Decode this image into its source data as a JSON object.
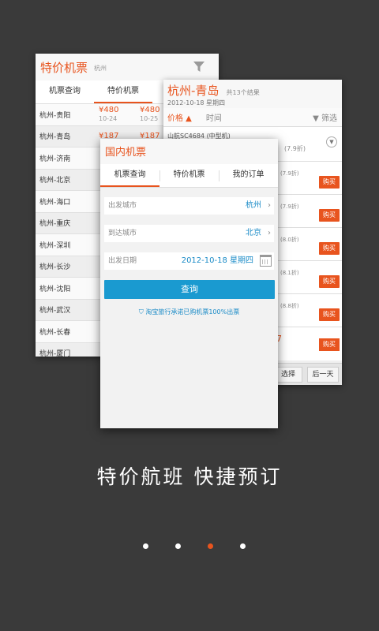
{
  "card1": {
    "title": "特价机票",
    "subtitle": "杭州",
    "tabs": [
      "机票查询",
      "特价机票"
    ],
    "rows": [
      {
        "city": "杭州-贵阳",
        "p1": "¥480",
        "d1": "10-24",
        "p2": "¥480",
        "d2": "10-25"
      },
      {
        "city": "杭州-青岛",
        "p1": "¥187",
        "d1": "",
        "p2": "¥187",
        "d2": ""
      },
      {
        "city": "杭州-济南"
      },
      {
        "city": "杭州-北京"
      },
      {
        "city": "杭州-海口"
      },
      {
        "city": "杭州-重庆"
      },
      {
        "city": "杭州-深圳"
      },
      {
        "city": "杭州-长沙"
      },
      {
        "city": "杭州-沈阳"
      },
      {
        "city": "杭州-武汉"
      },
      {
        "city": "杭州-长春"
      },
      {
        "city": "杭州-厦门"
      }
    ]
  },
  "card2": {
    "title": "杭州-青岛",
    "count": "共13个结果",
    "date": "2012-10-18 星期四",
    "sort_price": "价格 ▲",
    "sort_time": "时间",
    "filter": "▼ 筛选",
    "first_flight": "山航SC4684 (中型机)",
    "first_discount": "(7.9折)",
    "discounts": [
      "(7.9折)",
      "(7.9折)",
      "(8.0折)",
      "(8.1折)",
      "(8.8折)"
    ],
    "buy_label": "购买",
    "last_price_tail": "7",
    "btn_select": "选择",
    "btn_next_day": "后一天"
  },
  "card3": {
    "title": "国内机票",
    "tabs": [
      "机票查询",
      "特价机票",
      "我的订单"
    ],
    "from_label": "出发城市",
    "from_value": "杭州",
    "to_label": "到达城市",
    "to_value": "北京",
    "date_label": "出发日期",
    "date_value": "2012-10-18 星期四",
    "search_label": "查询",
    "promise": "淘宝旅行承诺已购机票100%出票"
  },
  "tagline": "特价航班 快捷预订",
  "colors": {
    "accent": "#e8541e",
    "blue": "#1a9ad0",
    "background": "#3a3a3a"
  },
  "pager": {
    "pages": 4,
    "active_index": 2
  }
}
